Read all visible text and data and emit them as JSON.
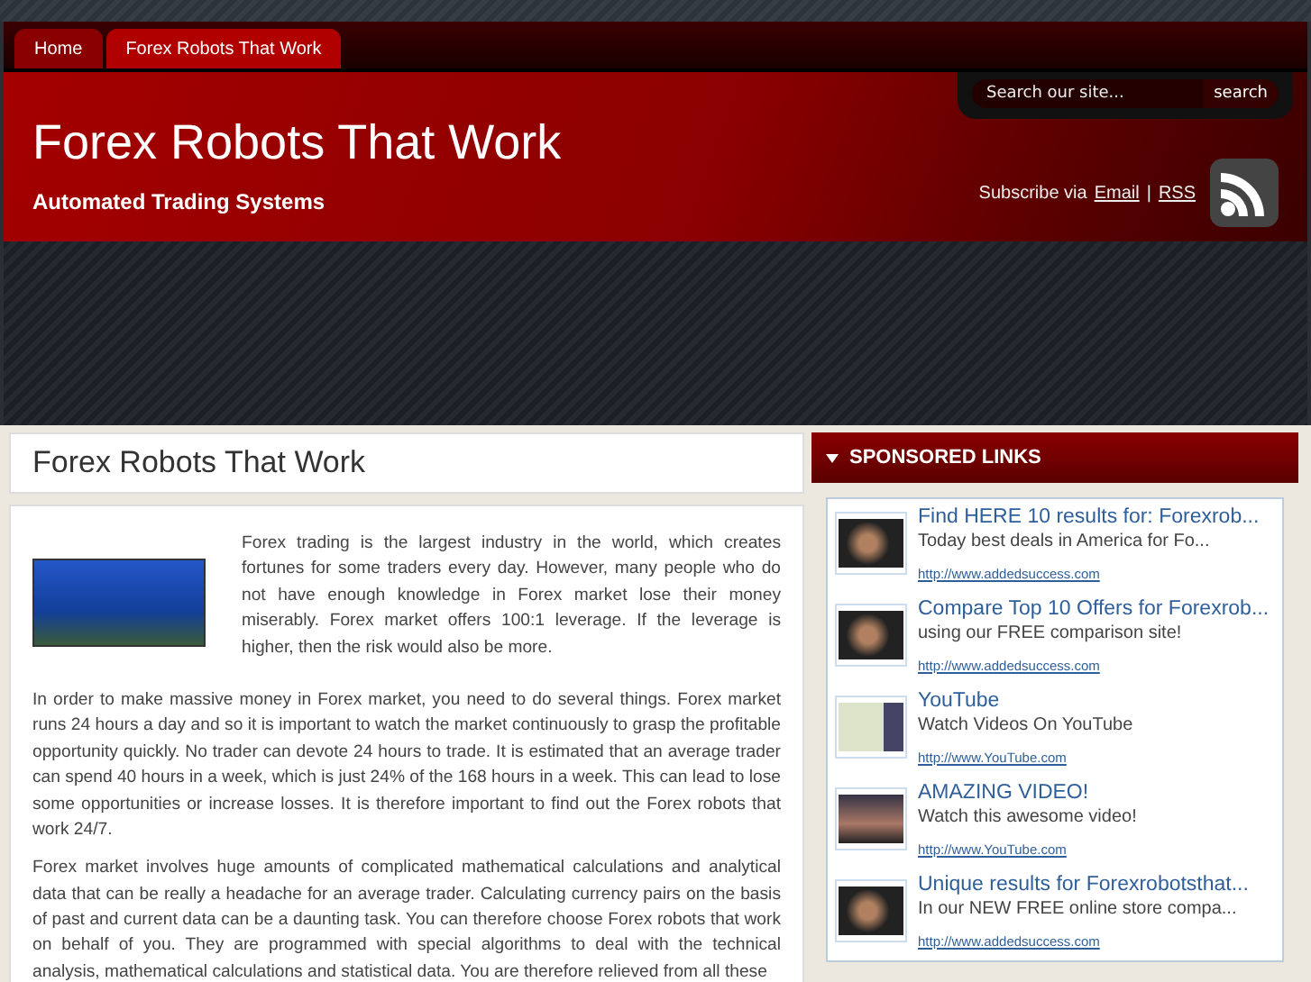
{
  "nav": {
    "tabs": [
      {
        "label": "Home",
        "selected": false
      },
      {
        "label": "Forex Robots That Work",
        "selected": true
      }
    ]
  },
  "header": {
    "title": "Forex Robots That Work",
    "tagline": "Automated Trading Systems",
    "search": {
      "placeholder": "Search our site...",
      "button": "search"
    },
    "subscribe": {
      "text": "Subscribe via",
      "email": "Email",
      "separator": "|",
      "rss": "RSS"
    }
  },
  "post": {
    "title": "Forex Robots That Work",
    "paragraphs": [
      "Forex trading is the largest industry in the world, which creates fortunes for some traders every day. However, many people who do not have enough knowledge in Forex market lose their money miserably. Forex market offers 100:1 leverage. If the leverage is higher, then the risk would also be more.",
      "In order to make massive money in Forex market, you need to do several things. Forex market runs 24 hours a day and so it is important to watch the market continuously to grasp the profitable opportunity quickly. No trader can devote 24 hours to trade. It is estimated that an average trader can spend 40 hours in a week, which is just 24% of the 168 hours in a week. This can lead to lose some opportunities or increase losses. It is therefore important to find out the Forex robots that work 24/7.",
      "Forex market involves huge amounts of complicated mathematical calculations and analytical data that can be really a headache for an average trader. Calculating currency pairs on the basis of past and current data can be a daunting task. You can therefore choose Forex robots that work on behalf of you. They are programmed with special algorithms to deal with the technical analysis, mathematical calculations and statistical data. You are therefore relieved from all these"
    ]
  },
  "sidebar": {
    "title": "SPONSORED LINKS",
    "expanded": true,
    "links": [
      {
        "title": "Find HERE 10 results for: Forexrob...",
        "description": "Today best deals in America for Fo...",
        "url": "http://www.addedsuccess.com",
        "kind": "hand"
      },
      {
        "title": "Compare Top 10 Offers for Forexrob...",
        "description": "using our FREE comparison site!",
        "url": "http://www.addedsuccess.com",
        "kind": "hand"
      },
      {
        "title": "YouTube",
        "description": "Watch Videos On YouTube",
        "url": "http://www.YouTube.com",
        "kind": "map"
      },
      {
        "title": "AMAZING VIDEO!",
        "description": "Watch this awesome video!",
        "url": "http://www.YouTube.com",
        "kind": "crowd"
      },
      {
        "title": "Unique results for Forexrobotsthat...",
        "description": "In our NEW FREE online store compa...",
        "url": "http://www.addedsuccess.com",
        "kind": "hand"
      }
    ]
  }
}
